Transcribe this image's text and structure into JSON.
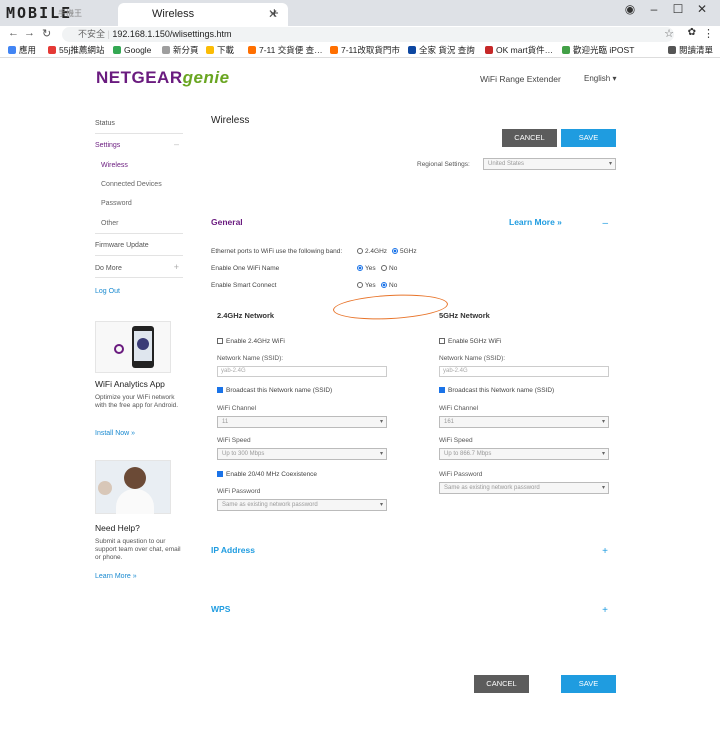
{
  "browser": {
    "logo_text": "MOBILE",
    "logo_small": "手機王",
    "tab_title": "Wireless",
    "url_insecure": "不安全",
    "url": "192.168.1.150/wlisettings.htm",
    "bookmarks": [
      {
        "label": "應用",
        "color": "#4285f4"
      },
      {
        "label": "55j推薦網站",
        "color": "#e53935"
      },
      {
        "label": "Google",
        "color": "#34a853"
      },
      {
        "label": "新分頁",
        "color": "#9e9e9e"
      },
      {
        "label": "下載",
        "color": "#fbbc05"
      },
      {
        "label": "7-11 交貨便 查…",
        "color": "#ff6f00"
      },
      {
        "label": "7-11改取貨門市",
        "color": "#ff6f00"
      },
      {
        "label": "全家 貨況 查詢",
        "color": "#0d47a1"
      },
      {
        "label": "OK mart貨件…",
        "color": "#c62828"
      },
      {
        "label": "歡迎光臨 iPOST",
        "color": "#43a047"
      },
      {
        "label": "閱讀清單",
        "color": "#555555"
      }
    ]
  },
  "header": {
    "brand_main": "NETGEAR",
    "brand_genie": "genie",
    "product": "WiFi Range Extender",
    "language": "English"
  },
  "sidebar": {
    "status": "Status",
    "settings": "Settings",
    "sub_items": [
      "Wireless",
      "Connected Devices",
      "Password",
      "Other"
    ],
    "firmware": "Firmware Update",
    "more": "Do More",
    "logout": "Log Out",
    "app_title": "WiFi Analytics App",
    "app_text": "Optimize your WiFi network with the free app for Android.",
    "app_link": "Install Now »",
    "help_title": "Need Help?",
    "help_text": "Submit a question to our support team over chat, email or phone.",
    "help_link": "Learn More »"
  },
  "main": {
    "title": "Wireless",
    "cancel": "CANCEL",
    "save": "SAVE",
    "regional_label": "Regional Settings:",
    "regional_value": "United States",
    "general": {
      "title": "General",
      "learn_more": "Learn More »",
      "ethernet_label": "Ethernet ports to WiFi use the following band:",
      "band_24": "2.4GHz",
      "band_5": "5GHz",
      "one_wifi_label": "Enable One WiFi Name",
      "smart_label": "Enable Smart Connect",
      "yes": "Yes",
      "no": "No"
    },
    "net24": {
      "title": "2.4GHz Network",
      "enable": "Enable 2.4GHz WiFi",
      "ssid_label": "Network Name (SSID):",
      "ssid_value": "yab-2.4G",
      "broadcast": "Broadcast this Network name (SSID)",
      "channel_label": "WiFi Channel",
      "channel_value": "11",
      "speed_label": "WiFi Speed",
      "speed_value": "Up to 300 Mbps",
      "coexist": "Enable 20/40 MHz Coexistence",
      "pwd_label": "WiFi Password",
      "pwd_value": "Same as existing network password"
    },
    "net5": {
      "title": "5GHz Network",
      "enable": "Enable 5GHz WiFi",
      "ssid_label": "Network Name (SSID):",
      "ssid_value": "yab-2.4G",
      "broadcast": "Broadcast this Network name (SSID)",
      "channel_label": "WiFi Channel",
      "channel_value": "161",
      "speed_label": "WiFi Speed",
      "speed_value": "Up to 866.7 Mbps",
      "pwd_label": "WiFi Password",
      "pwd_value": "Same as existing network password"
    },
    "ip_title": "IP Address",
    "wps_title": "WPS"
  }
}
